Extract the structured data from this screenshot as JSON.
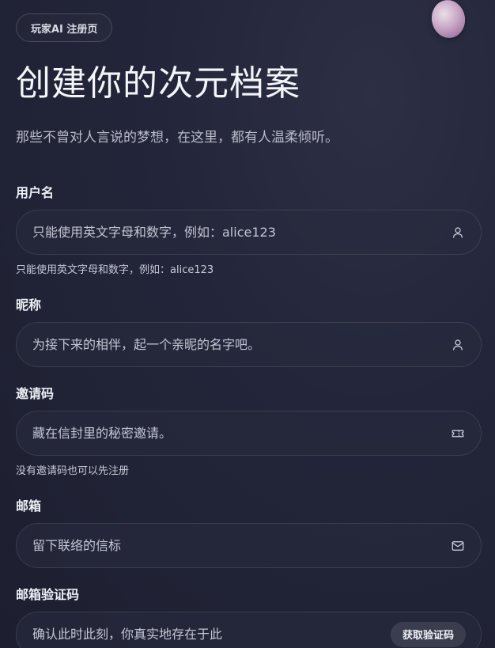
{
  "badge": "玩家AI 注册页",
  "title": "创建你的次元档案",
  "subtitle": "那些不曾对人言说的梦想，在这里，都有人温柔倾听。",
  "fields": {
    "username": {
      "label": "用户名",
      "placeholder": "只能使用英文字母和数字，例如：alice123",
      "value": "",
      "hint": "只能使用英文字母和数字，例如：alice123",
      "icon": "user-icon"
    },
    "nickname": {
      "label": "昵称",
      "placeholder": "为接下来的相伴，起一个亲昵的名字吧。",
      "value": "",
      "icon": "user-icon"
    },
    "invite": {
      "label": "邀请码",
      "placeholder": "藏在信封里的秘密邀请。",
      "value": "",
      "hint": "没有邀请码也可以先注册",
      "icon": "ticket-icon"
    },
    "email": {
      "label": "邮箱",
      "placeholder": "留下联络的信标",
      "value": "",
      "icon": "mail-icon"
    },
    "email_code": {
      "label": "邮箱验证码",
      "placeholder": "确认此时此刻，你真实地存在于此",
      "value": "",
      "button_label": "获取验证码"
    }
  },
  "colors": {
    "background": "#23253a",
    "field_background": "#282b3e",
    "text_primary": "#eceef5",
    "text_secondary": "#b9bcc9",
    "accent_orb": "#c8a6c6"
  }
}
